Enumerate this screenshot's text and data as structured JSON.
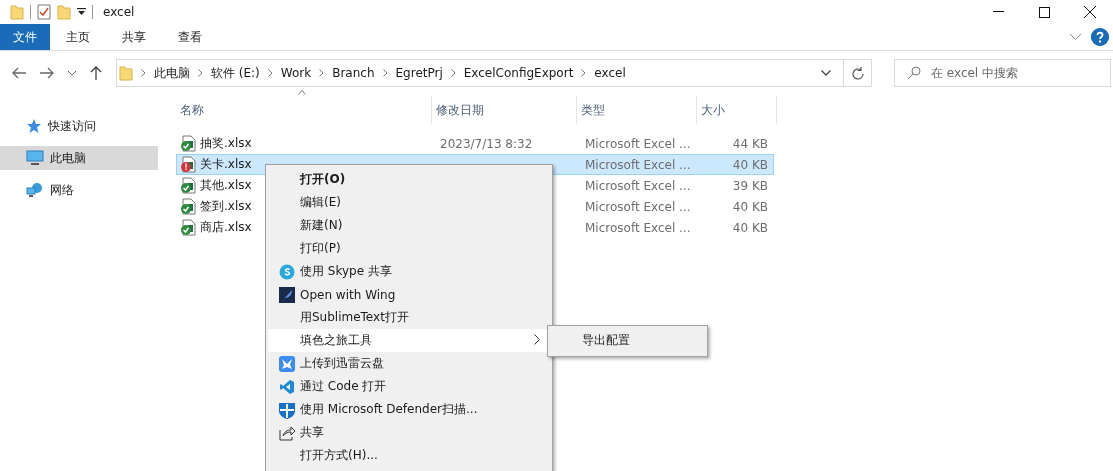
{
  "window": {
    "title": "excel"
  },
  "ribbon_tabs": [
    {
      "label": "文件",
      "selected": true
    },
    {
      "label": "主页",
      "selected": false
    },
    {
      "label": "共享",
      "selected": false
    },
    {
      "label": "查看",
      "selected": false
    }
  ],
  "address": {
    "crumbs": [
      "此电脑",
      "软件 (E:)",
      "Work",
      "Branch",
      "EgretPrj",
      "ExcelConfigExport",
      "excel"
    ]
  },
  "search": {
    "placeholder": "在 excel 中搜索"
  },
  "sidebar": {
    "items": [
      {
        "label": "快速访问",
        "kind": "star",
        "selected": false
      },
      {
        "label": "此电脑",
        "kind": "pc",
        "selected": true
      },
      {
        "label": "网络",
        "kind": "network",
        "selected": false
      }
    ]
  },
  "table": {
    "columns": [
      "名称",
      "修改日期",
      "类型",
      "大小"
    ],
    "rows": [
      {
        "name": "抽奖.xlsx",
        "date": "2023/7/13 8:32",
        "type": "Microsoft Excel ...",
        "size": "44 KB",
        "kind": "ok",
        "selected": false
      },
      {
        "name": "关卡.xlsx",
        "type": "Microsoft Excel ...",
        "size": "40 KB",
        "kind": "error",
        "selected": true
      },
      {
        "name": "其他.xlsx",
        "type": "Microsoft Excel ...",
        "size": "39 KB",
        "kind": "ok",
        "selected": false
      },
      {
        "name": "签到.xlsx",
        "type": "Microsoft Excel ...",
        "size": "40 KB",
        "kind": "ok",
        "selected": false
      },
      {
        "name": "商店.xlsx",
        "type": "Microsoft Excel ...",
        "size": "40 KB",
        "kind": "ok",
        "selected": false
      }
    ]
  },
  "context_menu": {
    "items": [
      {
        "label": "打开(O)",
        "kind": "default",
        "selected": false
      },
      {
        "label": "编辑(E)",
        "kind": "plain",
        "selected": false
      },
      {
        "label": "新建(N)",
        "kind": "plain",
        "selected": false
      },
      {
        "label": "打印(P)",
        "kind": "plain",
        "selected": false
      },
      {
        "label": "使用 Skype 共享",
        "kind": "skype",
        "selected": false
      },
      {
        "label": "Open with Wing",
        "kind": "wing",
        "selected": false
      },
      {
        "label": "用SublimeText打开",
        "kind": "plain",
        "selected": false
      },
      {
        "label": "填色之旅工具",
        "kind": "submenu",
        "selected": true,
        "submenu": [
          "导出配置"
        ]
      },
      {
        "label": "上传到迅雷云盘",
        "kind": "thunder",
        "selected": false
      },
      {
        "label": "通过 Code 打开",
        "kind": "vscode",
        "selected": false
      },
      {
        "label": "使用 Microsoft Defender扫描...",
        "kind": "defender",
        "selected": false
      },
      {
        "label": "共享",
        "kind": "share",
        "selected": false
      },
      {
        "label": "打开方式(H)...",
        "kind": "plain",
        "selected": false
      }
    ]
  }
}
